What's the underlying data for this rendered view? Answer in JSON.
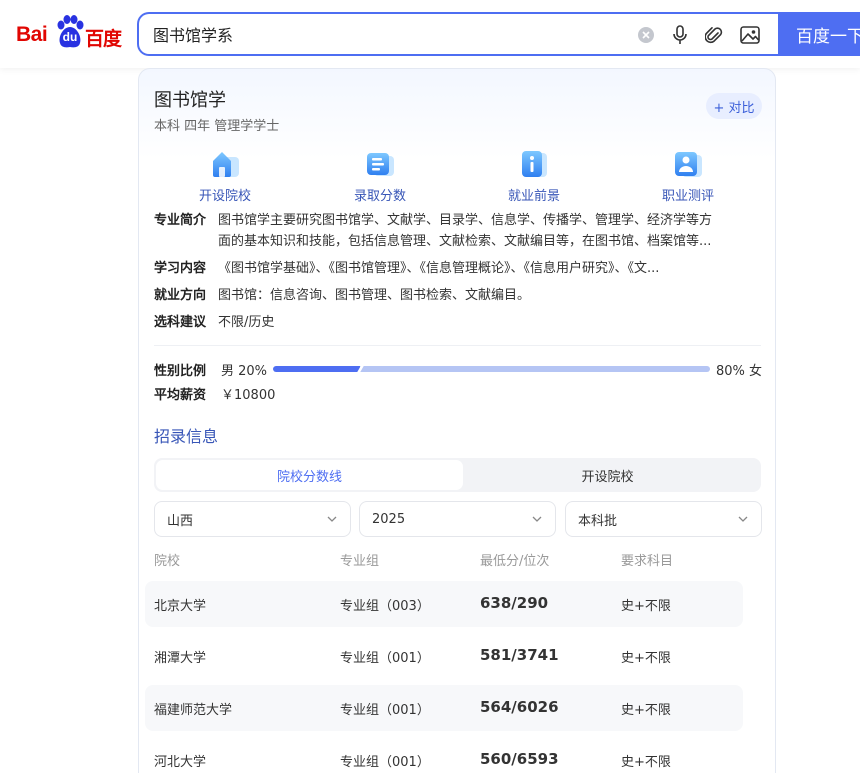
{
  "header": {
    "logo": {
      "latin": "Bai",
      "badge": "du",
      "chinese": "百度"
    },
    "search": {
      "query": "图书馆学系",
      "button_label": "百度一下"
    },
    "icons": [
      "clear-icon",
      "microphone-icon",
      "paperclip-icon",
      "image-search-icon"
    ]
  },
  "card": {
    "title": "图书馆学",
    "subtitle": "本科 四年 管理学学士",
    "compare_label": "+ 对比",
    "quick_links": [
      {
        "label": "开设院校",
        "icon": "school-icon"
      },
      {
        "label": "录取分数",
        "icon": "score-icon"
      },
      {
        "label": "就业前景",
        "icon": "career-icon"
      },
      {
        "label": "职业测评",
        "icon": "assessment-icon"
      }
    ],
    "info": {
      "intro_label": "专业简介",
      "intro_line1": "图书馆学主要研究图书馆学、文献学、目录学、信息学、传播学、管理学、经济学等方",
      "intro_line2": "面的基本知识和技能，包括信息管理、文献检索、文献编目等，在图书馆、档案馆等...",
      "content_label": "学习内容",
      "content_value": "《图书馆学基础》、《图书馆管理》、《信息管理概论》、《信息用户研究》、《文...",
      "career_label": "就业方向",
      "career_value": "图书馆：信息咨询、图书管理、图书检索、文献编目。",
      "subject_label": "选科建议",
      "subject_value": "不限/历史"
    },
    "gender": {
      "label": "性别比例",
      "male_text": "男 20%",
      "female_text": "80% 女",
      "male_fraction": 0.2
    },
    "salary": {
      "label": "平均薪资",
      "value": "￥10800"
    },
    "admission": {
      "title": "招录信息",
      "tabs": [
        "院校分数线",
        "开设院校"
      ],
      "filters": [
        "山西",
        "2025",
        "本科批"
      ],
      "columns": [
        "院校",
        "专业组",
        "最低分/位次",
        "要求科目"
      ],
      "rows": [
        {
          "school": "北京大学",
          "group": "专业组（003）",
          "score": "638/290",
          "subjects": "史+不限"
        },
        {
          "school": "湘潭大学",
          "group": "专业组（001）",
          "score": "581/3741",
          "subjects": "史+不限"
        },
        {
          "school": "福建师范大学",
          "group": "专业组（001）",
          "score": "564/6026",
          "subjects": "史+不限"
        },
        {
          "school": "河北大学",
          "group": "专业组（001）",
          "score": "560/6593",
          "subjects": "史+不限"
        }
      ]
    }
  },
  "colors": {
    "brand_red": "#e10602",
    "accent_blue": "#4e6ef2",
    "link_blue": "#3856b7",
    "bar_light": "#b5c5f4"
  }
}
